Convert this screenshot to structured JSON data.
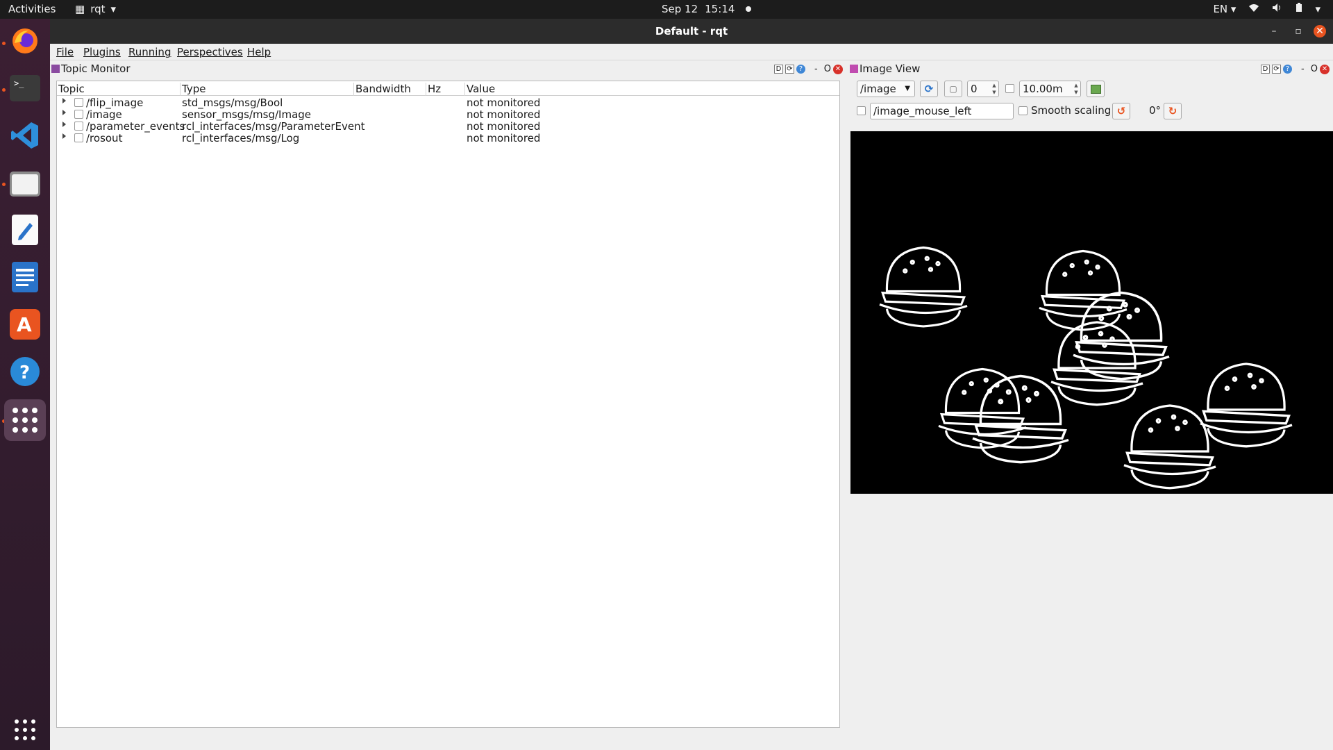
{
  "topbar": {
    "activities": "Activities",
    "app_name": "rqt",
    "date": "Sep 12",
    "time": "15:14",
    "lang": "EN"
  },
  "window": {
    "title": "Default - rqt"
  },
  "menu": [
    "File",
    "Plugins",
    "Running",
    "Perspectives",
    "Help"
  ],
  "topic_monitor": {
    "title": "Topic Monitor",
    "dock_label_d": "D",
    "dock_label_min": "-",
    "dock_label_o": "O",
    "columns": [
      "Topic",
      "Type",
      "Bandwidth",
      "Hz",
      "Value"
    ],
    "rows": [
      {
        "topic": "/flip_image",
        "type": "std_msgs/msg/Bool",
        "bandwidth": "",
        "hz": "",
        "value": "not monitored"
      },
      {
        "topic": "/image",
        "type": "sensor_msgs/msg/Image",
        "bandwidth": "",
        "hz": "",
        "value": "not monitored"
      },
      {
        "topic": "/parameter_events",
        "type": "rcl_interfaces/msg/ParameterEvent",
        "bandwidth": "",
        "hz": "",
        "value": "not monitored"
      },
      {
        "topic": "/rosout",
        "type": "rcl_interfaces/msg/Log",
        "bandwidth": "",
        "hz": "",
        "value": "not monitored"
      }
    ]
  },
  "image_view": {
    "title": "Image View",
    "dock_label_d": "D",
    "dock_label_min": "-",
    "dock_label_o": "O",
    "topic_select": "/image",
    "rate_value": "0",
    "timeout_value": "10.00m",
    "mouse_topic": "/image_mouse_left",
    "smooth_label": "Smooth scaling",
    "rotation": "0°"
  },
  "icons": {
    "accent": "#e95420",
    "dock": [
      "firefox-icon",
      "terminal-icon",
      "vscode-icon",
      "files-icon",
      "text-editor-icon",
      "writer-icon",
      "software-icon",
      "help-icon",
      "app-grid-icon",
      "show-apps-icon"
    ]
  }
}
